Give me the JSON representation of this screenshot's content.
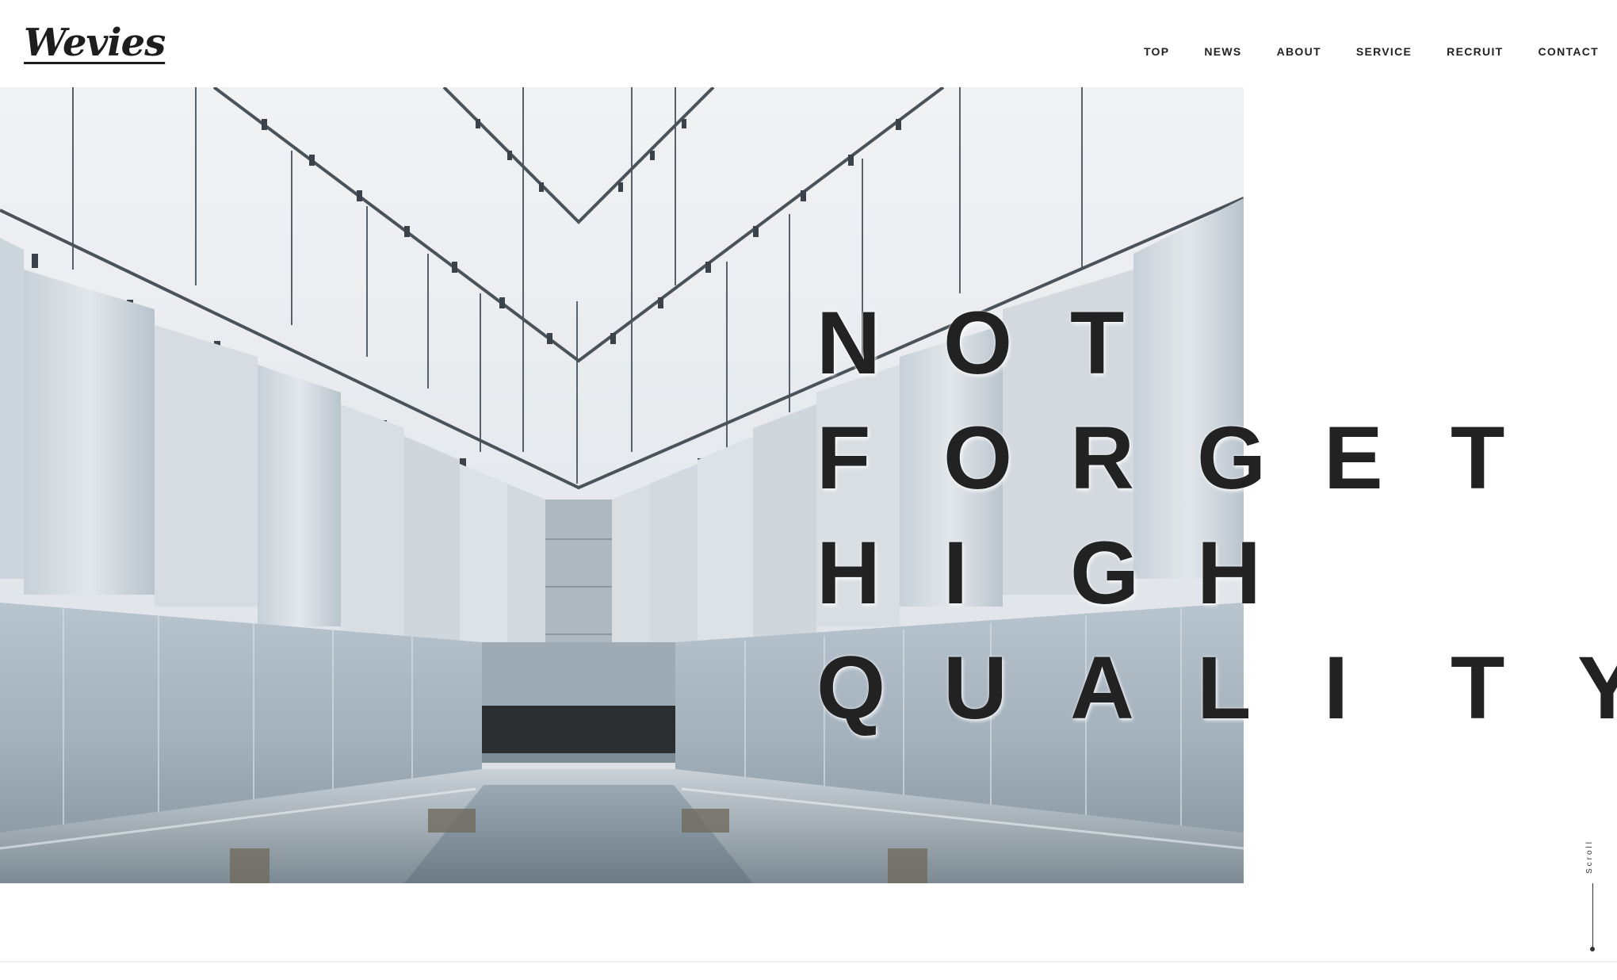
{
  "brand": {
    "logo_text": "Wevies"
  },
  "nav": {
    "items": [
      "TOP",
      "NEWS",
      "ABOUT",
      "SERVICE",
      "RECRUIT",
      "CONTACT"
    ]
  },
  "hero": {
    "headline": [
      "NOT",
      "FORGET",
      "HIGH",
      "QUALITY"
    ],
    "image_subject": "architecture-hall-photo"
  },
  "scroll": {
    "label": "Scroll"
  },
  "colors": {
    "text": "#222222",
    "background": "#ffffff",
    "photo_tint": "#a9b6c1"
  }
}
